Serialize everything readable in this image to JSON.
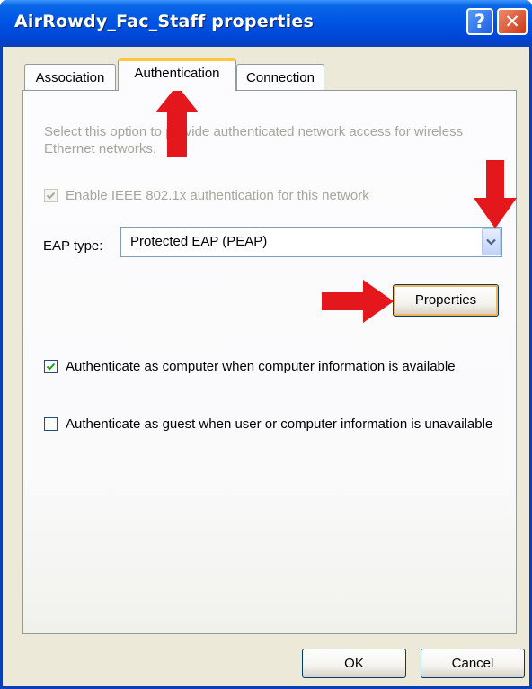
{
  "window": {
    "title": "AirRowdy_Fac_Staff properties",
    "help_glyph": "?",
    "close_glyph": "✕"
  },
  "tabs": [
    {
      "label": "Association",
      "active": false
    },
    {
      "label": "Authentication",
      "active": true
    },
    {
      "label": "Connection",
      "active": false
    }
  ],
  "description": "Select this option to provide authenticated network access for wireless Ethernet networks.",
  "enable_8021x": {
    "label": "Enable IEEE 802.1x authentication for this network",
    "checked": true,
    "disabled": true
  },
  "eap": {
    "label": "EAP type:",
    "value": "Protected EAP (PEAP)"
  },
  "properties_button": "Properties",
  "auth_as_computer": {
    "label": "Authenticate as computer when computer information is available",
    "checked": true
  },
  "auth_as_guest": {
    "label": "Authenticate as guest when user or computer information is unavailable",
    "checked": false
  },
  "footer": {
    "ok_label": "OK",
    "cancel_label": "Cancel"
  },
  "colors": {
    "title_bar": "#0055E5",
    "dialog_bg": "#ECE9D8",
    "active_tab_highlight": "#FFC83C",
    "annotation_arrow": "#E4171C",
    "disabled_text": "#A7A69B"
  },
  "icons": [
    "help-icon",
    "close-icon",
    "checkmark-icon",
    "dropdown-arrow-icon",
    "red-arrow-annotation"
  ]
}
